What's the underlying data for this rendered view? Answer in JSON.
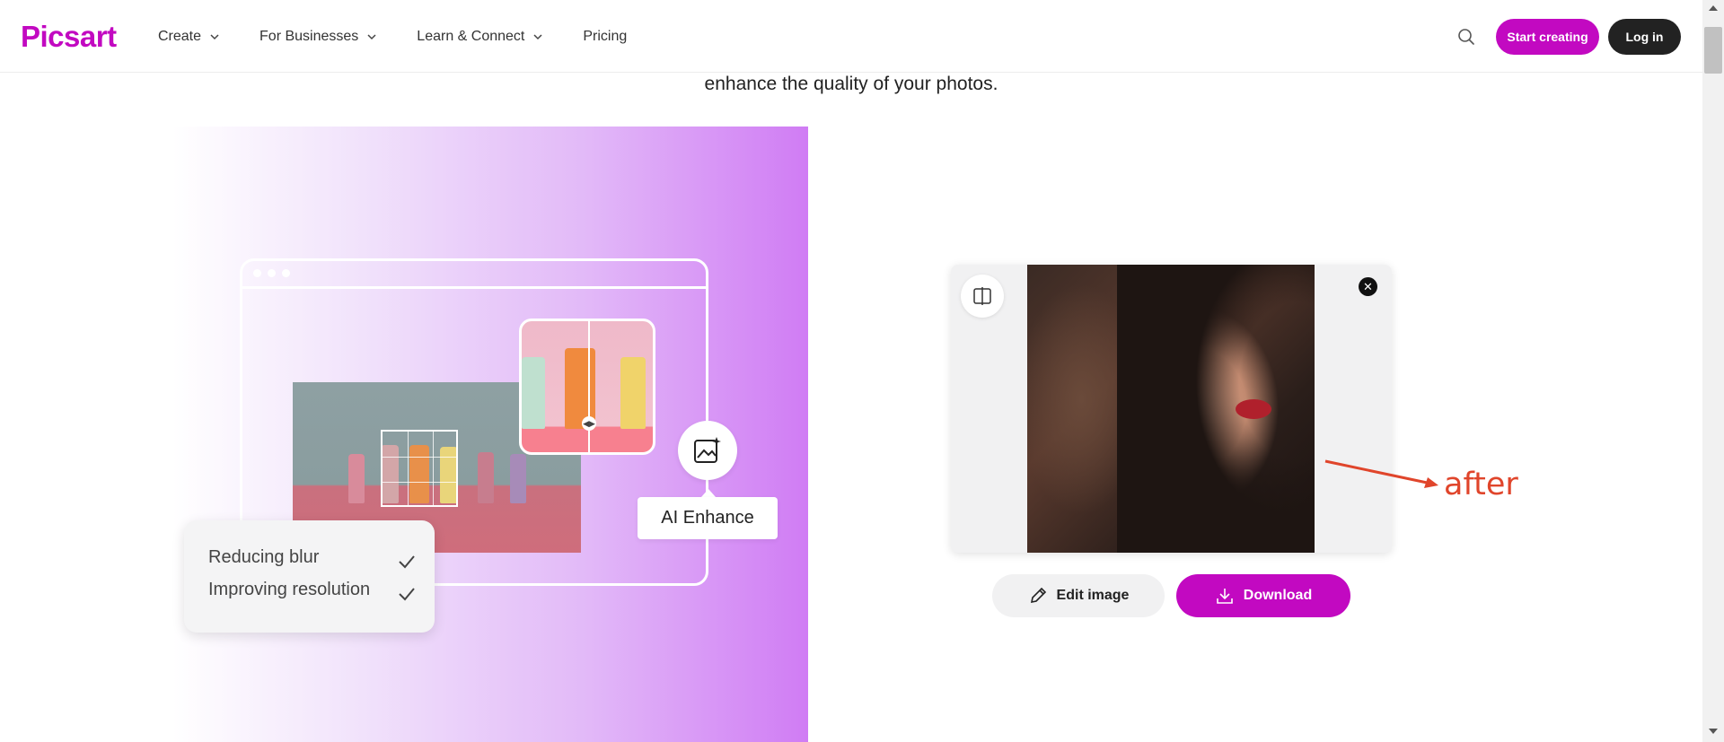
{
  "header": {
    "logo": "Picsart",
    "nav": [
      {
        "label": "Create",
        "has_dropdown": true
      },
      {
        "label": "For Businesses",
        "has_dropdown": true
      },
      {
        "label": "Learn & Connect",
        "has_dropdown": true
      },
      {
        "label": "Pricing",
        "has_dropdown": false
      }
    ],
    "search_icon": "search-icon",
    "start_creating_label": "Start creating",
    "login_label": "Log in"
  },
  "hero": {
    "subtitle": "enhance the quality of your photos."
  },
  "illustration": {
    "enhance_label": "AI Enhance",
    "checklist": [
      "Reducing blur",
      "Improving resolution"
    ]
  },
  "result": {
    "compare_icon": "compare-icon",
    "close_icon": "close-icon",
    "edit_label": "Edit image",
    "download_label": "Download"
  },
  "annotation": {
    "text": "after",
    "color": "#e0452b"
  },
  "colors": {
    "brand": "#c209c1",
    "dark_button": "#222222"
  }
}
